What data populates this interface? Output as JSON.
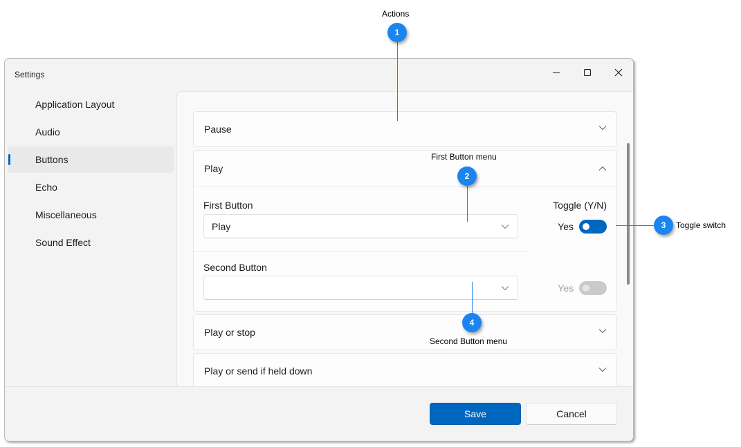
{
  "window": {
    "title": "Settings",
    "controls": {
      "minimize": "minimize",
      "maximize": "maximize",
      "close": "close"
    }
  },
  "sidebar": {
    "items": [
      {
        "label": "Application Layout",
        "selected": false
      },
      {
        "label": "Audio",
        "selected": false
      },
      {
        "label": "Buttons",
        "selected": true
      },
      {
        "label": "Echo",
        "selected": false
      },
      {
        "label": "Miscellaneous",
        "selected": false
      },
      {
        "label": "Sound Effect",
        "selected": false
      }
    ]
  },
  "content": {
    "expanders": [
      {
        "label": "Pause",
        "expanded": false,
        "chevron": "chevron-down-icon"
      },
      {
        "label": "Play",
        "expanded": true,
        "chevron": "chevron-up-icon"
      },
      {
        "label": "Play or stop",
        "expanded": false,
        "chevron": "chevron-down-icon"
      },
      {
        "label": "Play or send if held down",
        "expanded": false,
        "chevron": "chevron-down-icon"
      }
    ],
    "play_panel": {
      "first_button": {
        "label": "First Button",
        "value": "Play"
      },
      "second_button": {
        "label": "Second Button",
        "value": ""
      },
      "toggle_header": "Toggle (Y/N)",
      "toggle_first": {
        "label": "Yes",
        "on": true,
        "enabled": true
      },
      "toggle_second": {
        "label": "Yes",
        "on": false,
        "enabled": false
      }
    }
  },
  "footer": {
    "save_label": "Save",
    "cancel_label": "Cancel"
  },
  "callouts": [
    {
      "number": "1",
      "label": "Actions"
    },
    {
      "number": "2",
      "label": "First Button menu"
    },
    {
      "number": "3",
      "label": "Toggle switch"
    },
    {
      "number": "4",
      "label": "Second Button menu"
    }
  ],
  "colors": {
    "accent": "#0067c0",
    "callout": "#1a85f0",
    "window_bg": "#f3f3f3",
    "content_bg": "#f9f9f9"
  }
}
